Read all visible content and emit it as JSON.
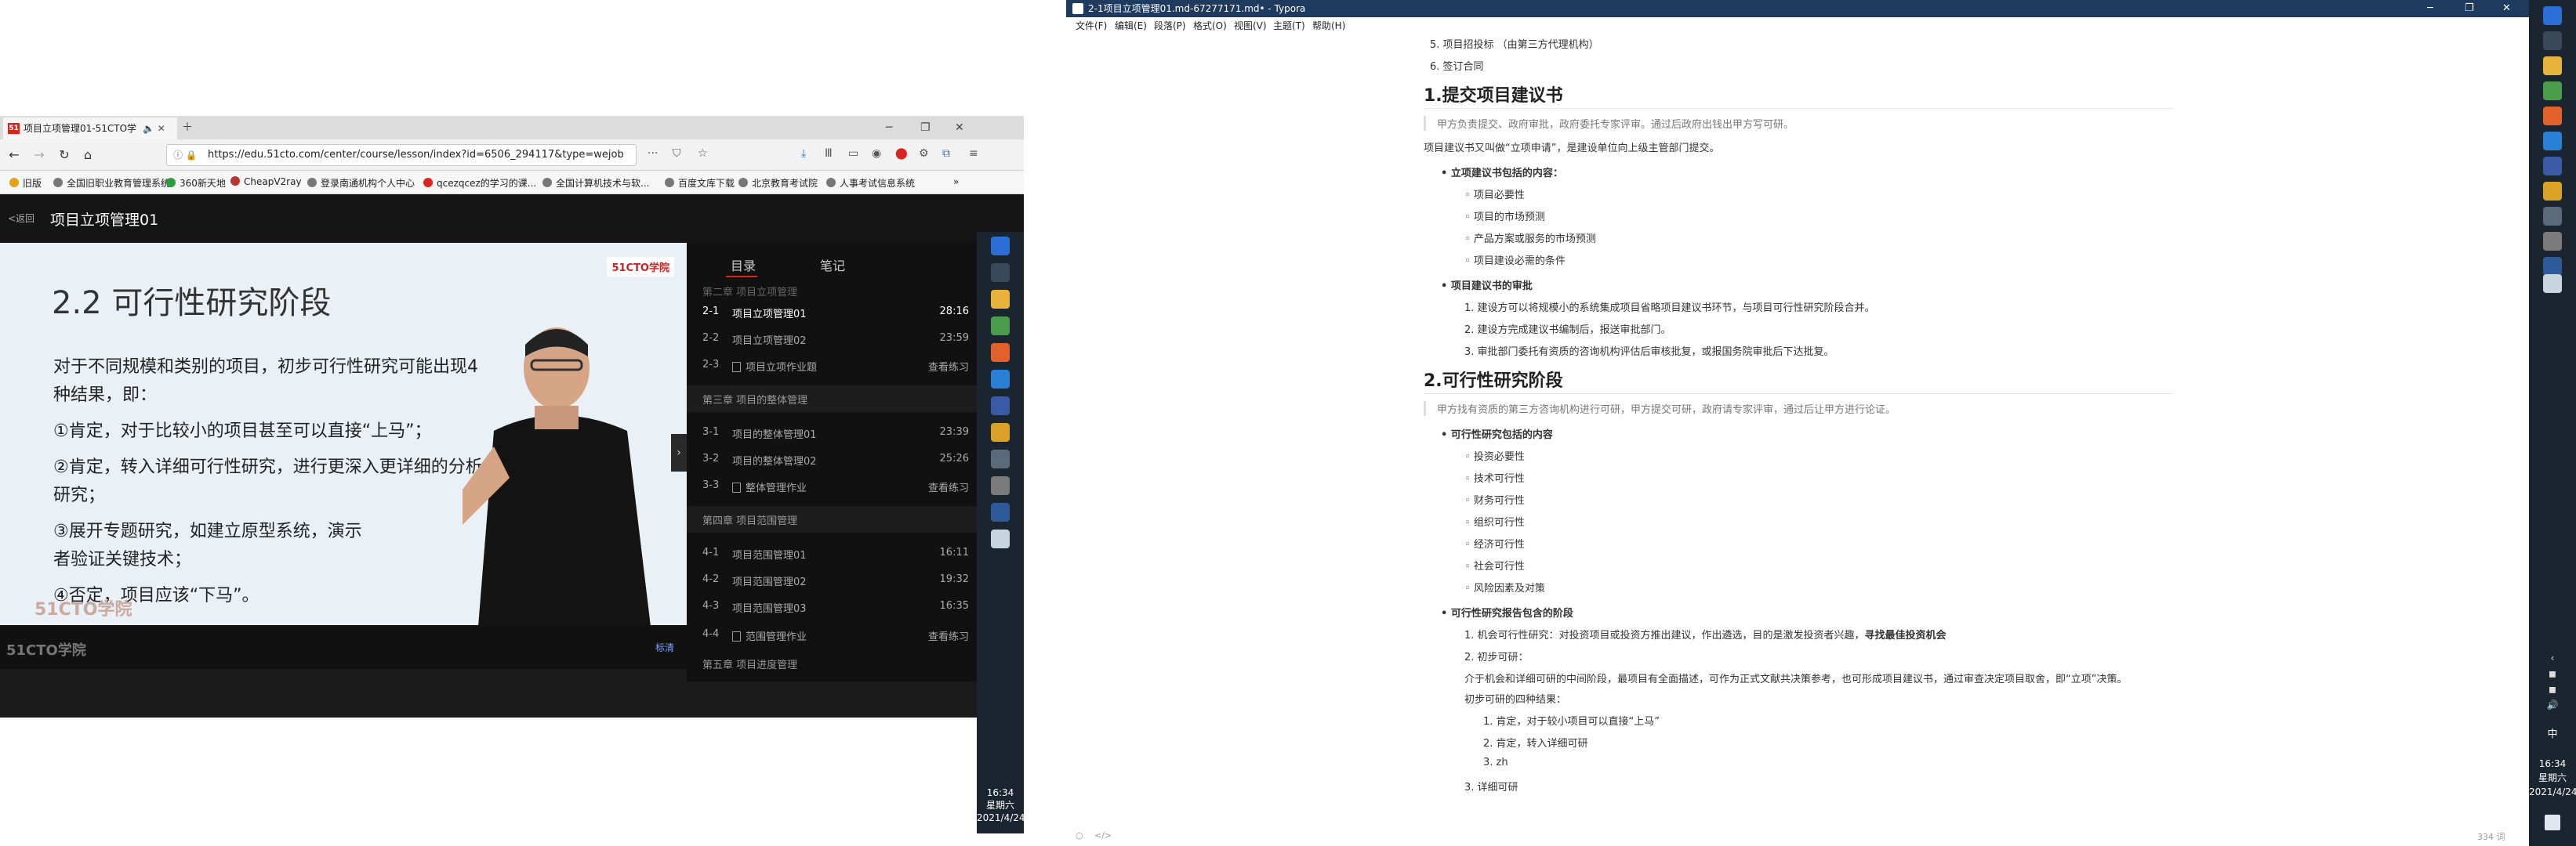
{
  "browser": {
    "tab_title": "项目立项管理01-51CTO学",
    "favicon_text": "51",
    "url": "https://edu.51cto.com/center/course/lesson/index?id=6506_294117&type=wejob",
    "bookmarks": [
      "旧版",
      "全国旧职业教育管理系统",
      "360新天地",
      "CheapV2ray",
      "登录南通机构个人中心",
      "qcezqcez的学习的课...",
      "全国计算机技术与软...",
      "百度文库下载",
      "北京教育考试院",
      "人事考试信息系统"
    ],
    "back_label": "<返回",
    "course_title": "项目立项管理01"
  },
  "slide": {
    "title": "2.2   可行性研究阶段",
    "logo": "51CTO学院",
    "lines": [
      "对于不同规模和类别的项目，初步可行性研究可能出现4",
      "种结果，即：",
      "①肯定，对于比较小的项目甚至可以直接“上马”；",
      "②肯定，转入详细可行性研究，进行更深入更详细的分析",
      "研究；",
      "③展开专题研究，如建立原型系统，演示",
      "者验证关键技术；",
      "④否定，项目应该“下马”。"
    ],
    "watermark": "51CTO学院"
  },
  "video_bar": {
    "logo": "51CTO学院",
    "quality": "标清"
  },
  "playlist": {
    "tabs": [
      "目录",
      "笔记"
    ],
    "chapter_top": "第二章 项目立项管理",
    "items": [
      {
        "num": "2-1",
        "name": "项目立项管理01",
        "dur": "28:16",
        "active": true,
        "doc": false
      },
      {
        "num": "2-2",
        "name": "项目立项管理02",
        "dur": "23:59",
        "active": false,
        "doc": false
      },
      {
        "num": "2-3",
        "name": "项目立项作业题",
        "dur": "查看练习",
        "active": false,
        "doc": true
      }
    ],
    "chapter3": "第三章 项目的整体管理",
    "items3": [
      {
        "num": "3-1",
        "name": "项目的整体管理01",
        "dur": "23:39",
        "doc": false
      },
      {
        "num": "3-2",
        "name": "项目的整体管理02",
        "dur": "25:26",
        "doc": false
      },
      {
        "num": "3-3",
        "name": "整体管理作业",
        "dur": "查看练习",
        "doc": true
      }
    ],
    "chapter4": "第四章 项目范围管理",
    "items4": [
      {
        "num": "4-1",
        "name": "项目范围管理01",
        "dur": "16:11",
        "doc": false
      },
      {
        "num": "4-2",
        "name": "项目范围管理02",
        "dur": "19:32",
        "doc": false
      },
      {
        "num": "4-3",
        "name": "项目范围管理03",
        "dur": "16:35",
        "doc": false
      },
      {
        "num": "4-4",
        "name": "范围管理作业",
        "dur": "查看练习",
        "doc": true
      }
    ],
    "chapter5": "第五章 项目进度管理"
  },
  "clock": {
    "time": "16:34",
    "weekday": "星期六",
    "date": "2021/4/24",
    "ime": "中"
  },
  "typora": {
    "title": "2-1项目立项管理01.md-67277171.md• - Typora",
    "menu": [
      "文件(F)",
      "编辑(E)",
      "段落(P)",
      "格式(O)",
      "视图(V)",
      "主题(T)",
      "帮助(H)"
    ],
    "lines": {
      "l1": "5. 项目招投标  （由第三方代理机构）",
      "l2": "6. 签订合同",
      "h1": "1.提交项目建议书",
      "q1": "甲方负责提交、政府审批，政府委托专家评审。通过后政府出钱出甲方写可研。",
      "p1": "项目建议书又叫做“立项申请”，是建设单位向上级主管部门提交。",
      "b1": "立项建议书包括的内容：",
      "c1": "项目必要性",
      "c2": "项目的市场预测",
      "c3": "产品方案或服务的市场预测",
      "c4": "项目建设必需的条件",
      "b2": "项目建议书的审批",
      "n1": "1. 建设方可以将规模小的系统集成项目省略项目建议书环节，与项目可行性研究阶段合并。",
      "n2": "2. 建设方完成建议书编制后，报送审批部门。",
      "n3": "3. 审批部门委托有资质的咨询机构评估后审核批复，或报国务院审批后下达批复。",
      "h2": "2.可行性研究阶段",
      "q2": "甲方找有资质的第三方咨询机构进行可研，甲方提交可研，政府请专家评审，通过后让甲方进行论证。",
      "b3": "可行性研究包括的内容",
      "d1": "投资必要性",
      "d2": "技术可行性",
      "d3": "财务可行性",
      "d4": "组织可行性",
      "d5": "经济可行性",
      "d6": "社会可行性",
      "d7": "风险因素及对策",
      "b4": "可行性研究报告包含的阶段",
      "m1a": "1. 机会可行性研究：对投资项目或投资方推出建议，作出遴选，目的是激发投资者兴趣，",
      "m1b": "寻找最佳投资机会",
      "m2": "2. 初步可研：",
      "m2p": "介于机会和详细可研的中间阶段，最项目有全面描述，可作为正式文献共决策参考，也可形成项目建议书，通过审查决定项目取舍，即“立项”决策。",
      "m2q": "初步可研的四种结果：",
      "r1": "1. 肯定，对于较小项目可以直接“上马”",
      "r2": "2. 肯定，转入详细可研",
      "r3": "3. zh",
      "m3": "3. 详细可研"
    },
    "footer_word_count": "334 词"
  },
  "colors": {
    "taskbar": "#1a2530",
    "typora_title": "#1e3a5f",
    "accent_red": "#d9261c"
  }
}
